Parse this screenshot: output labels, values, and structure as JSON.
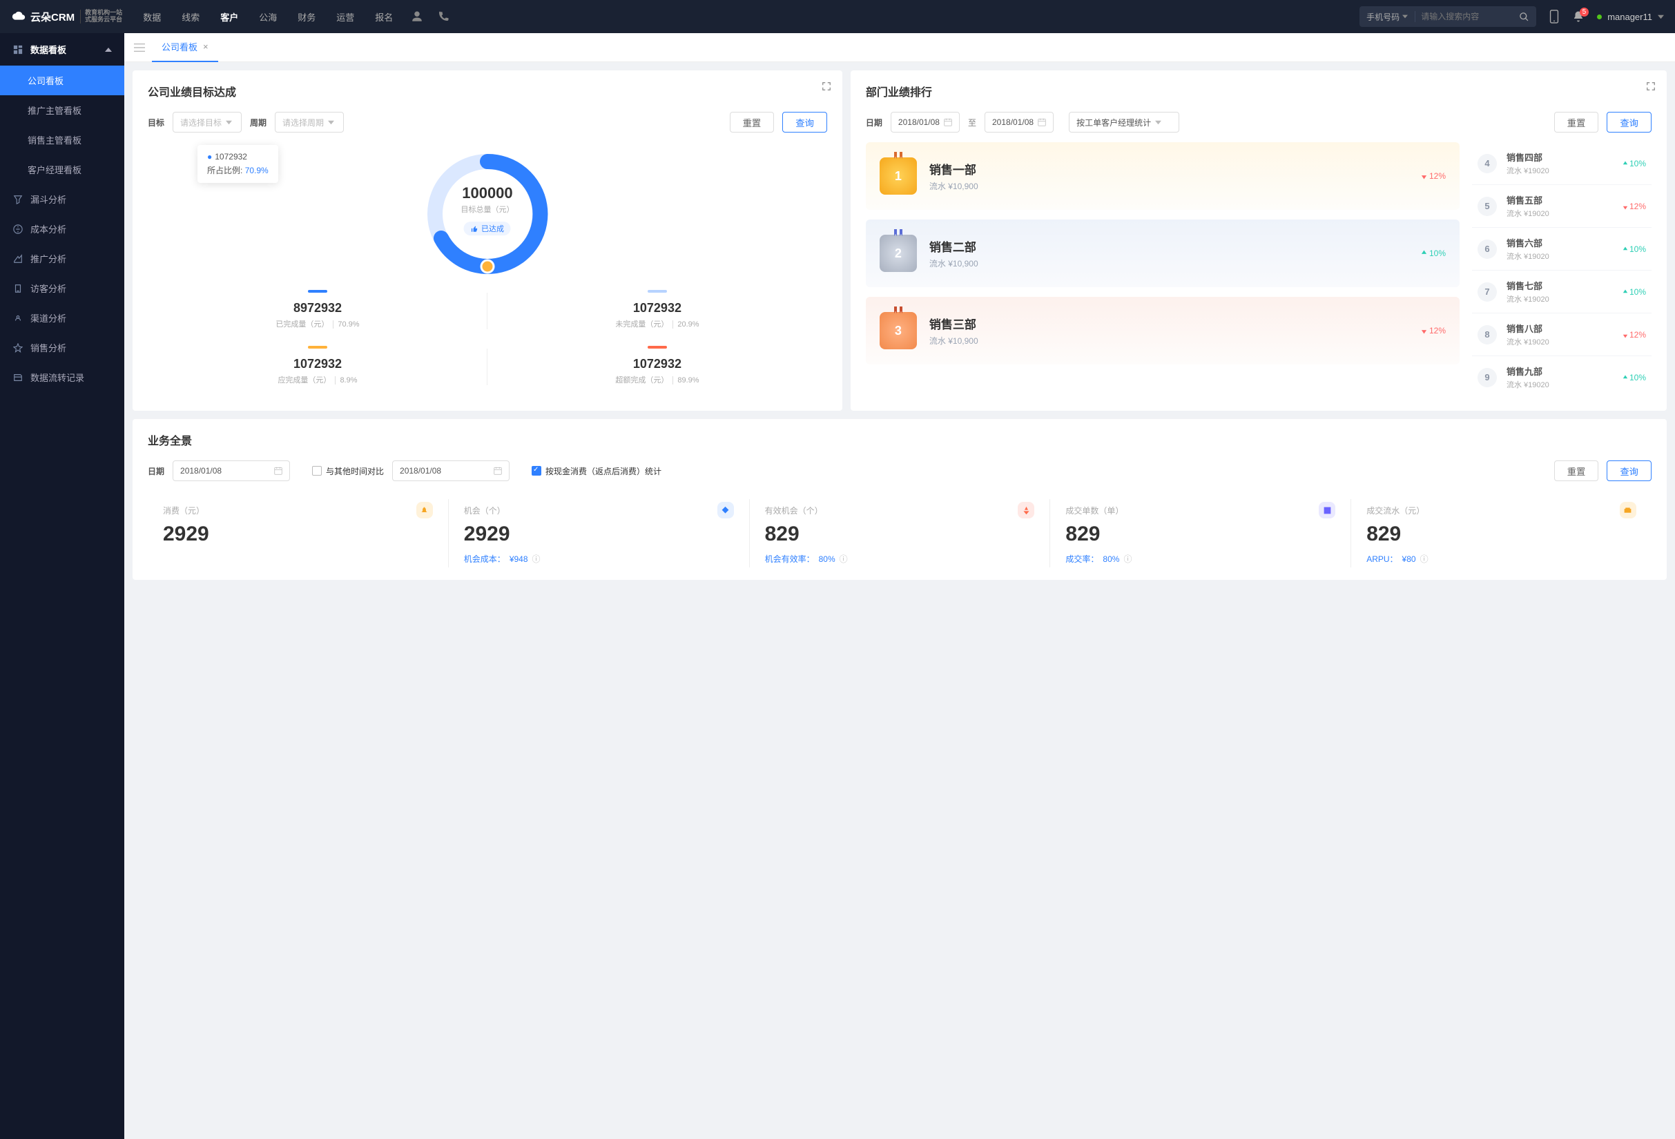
{
  "brand": {
    "main": "云朵CRM",
    "sub1": "教育机构一站",
    "sub2": "式服务云平台"
  },
  "nav": {
    "items": [
      "数据",
      "线索",
      "客户",
      "公海",
      "财务",
      "运营",
      "报名"
    ],
    "active_index": 2
  },
  "search": {
    "selector": "手机号码",
    "placeholder": "请输入搜索内容"
  },
  "notif_count": "5",
  "user": {
    "name": "manager11"
  },
  "sidebar": {
    "group": {
      "title": "数据看板"
    },
    "items": [
      "公司看板",
      "推广主管看板",
      "销售主管看板",
      "客户经理看板"
    ],
    "items2": [
      {
        "icon": "funnel",
        "label": "漏斗分析"
      },
      {
        "icon": "cost",
        "label": "成本分析"
      },
      {
        "icon": "promo",
        "label": "推广分析"
      },
      {
        "icon": "visitor",
        "label": "访客分析"
      },
      {
        "icon": "channel",
        "label": "渠道分析"
      },
      {
        "icon": "sales",
        "label": "销售分析"
      },
      {
        "icon": "flow",
        "label": "数据流转记录"
      }
    ],
    "active_sub": 0
  },
  "tabs": {
    "current": "公司看板"
  },
  "target_panel": {
    "title": "公司业绩目标达成",
    "filters": {
      "target_label": "目标",
      "target_ph": "请选择目标",
      "period_label": "周期",
      "period_ph": "请选择周期",
      "reset": "重置",
      "query": "查询"
    },
    "tooltip": {
      "value": "1072932",
      "ratio_label": "所占比例:",
      "ratio": "70.9%"
    },
    "center": {
      "total": "100000",
      "total_label": "目标总量（元）",
      "thumb": "已达成"
    },
    "stats": [
      {
        "bar": "#2f80ff",
        "value": "8972932",
        "label": "已完成量（元）",
        "pct": "70.9%"
      },
      {
        "bar": "#b7d3ff",
        "value": "1072932",
        "label": "未完成量（元）",
        "pct": "20.9%"
      },
      {
        "bar": "#ffb23a",
        "value": "1072932",
        "label": "应完成量（元）",
        "pct": "8.9%"
      },
      {
        "bar": "#ff6a4a",
        "value": "1072932",
        "label": "超额完成（元）",
        "pct": "89.9%"
      }
    ]
  },
  "chart_data": {
    "type": "donut",
    "title": "公司业绩目标达成",
    "total_label": "目标总量（元）",
    "total": 100000,
    "slices": [
      {
        "name": "已完成量",
        "value": 8972932,
        "pct": 70.9,
        "color": "#2f80ff"
      },
      {
        "name": "未完成量",
        "value": 1072932,
        "pct": 20.9,
        "color": "#b7d3ff"
      }
    ],
    "aux": [
      {
        "name": "应完成量",
        "value": 1072932,
        "pct": 8.9,
        "color": "#ffb23a"
      },
      {
        "name": "超额完成",
        "value": 1072932,
        "pct": 89.9,
        "color": "#ff6a4a"
      }
    ],
    "tooltip": {
      "value": 1072932,
      "ratio": 70.9
    }
  },
  "rank_panel": {
    "title": "部门业绩排行",
    "filters": {
      "date_label": "日期",
      "date1": "2018/01/08",
      "sep": "至",
      "date2": "2018/01/08",
      "stat_sel": "按工单客户经理统计",
      "reset": "重置",
      "query": "查询"
    },
    "top3": [
      {
        "rank": "1",
        "name": "销售一部",
        "flow": "流水 ¥10,900",
        "trend": "12%",
        "dir": "down"
      },
      {
        "rank": "2",
        "name": "销售二部",
        "flow": "流水 ¥10,900",
        "trend": "10%",
        "dir": "up"
      },
      {
        "rank": "3",
        "name": "销售三部",
        "flow": "流水 ¥10,900",
        "trend": "12%",
        "dir": "down"
      }
    ],
    "rest": [
      {
        "rank": "4",
        "name": "销售四部",
        "flow": "流水 ¥19020",
        "trend": "10%",
        "dir": "up"
      },
      {
        "rank": "5",
        "name": "销售五部",
        "flow": "流水 ¥19020",
        "trend": "12%",
        "dir": "down"
      },
      {
        "rank": "6",
        "name": "销售六部",
        "flow": "流水 ¥19020",
        "trend": "10%",
        "dir": "up"
      },
      {
        "rank": "7",
        "name": "销售七部",
        "flow": "流水 ¥19020",
        "trend": "10%",
        "dir": "up"
      },
      {
        "rank": "8",
        "name": "销售八部",
        "flow": "流水 ¥19020",
        "trend": "12%",
        "dir": "down"
      },
      {
        "rank": "9",
        "name": "销售九部",
        "flow": "流水 ¥19020",
        "trend": "10%",
        "dir": "up"
      }
    ]
  },
  "overview": {
    "title": "业务全景",
    "filters": {
      "date_label": "日期",
      "date1": "2018/01/08",
      "compare_label": "与其他时间对比",
      "date2": "2018/01/08",
      "cash_label": "按现金消费（返点后消费）统计",
      "reset": "重置",
      "query": "查询"
    },
    "kpis": [
      {
        "label": "消费（元）",
        "value": "2929",
        "foot": "",
        "icon_bg": "#fff2da",
        "icon_fg": "#f6a623"
      },
      {
        "label": "机会（个）",
        "value": "2929",
        "foot_label": "机会成本：",
        "foot_val": "¥948",
        "icon_bg": "#e6f0ff",
        "icon_fg": "#2f80ff"
      },
      {
        "label": "有效机会（个）",
        "value": "829",
        "foot_label": "机会有效率：",
        "foot_val": "80%",
        "icon_bg": "#ffe9e6",
        "icon_fg": "#ff6a4a"
      },
      {
        "label": "成交单数（单）",
        "value": "829",
        "foot_label": "成交率：",
        "foot_val": "80%",
        "icon_bg": "#eae9ff",
        "icon_fg": "#6a63ff"
      },
      {
        "label": "成交流水（元）",
        "value": "829",
        "foot_label": "ARPU：",
        "foot_val": "¥80",
        "icon_bg": "#fff2da",
        "icon_fg": "#f6a623"
      }
    ]
  }
}
